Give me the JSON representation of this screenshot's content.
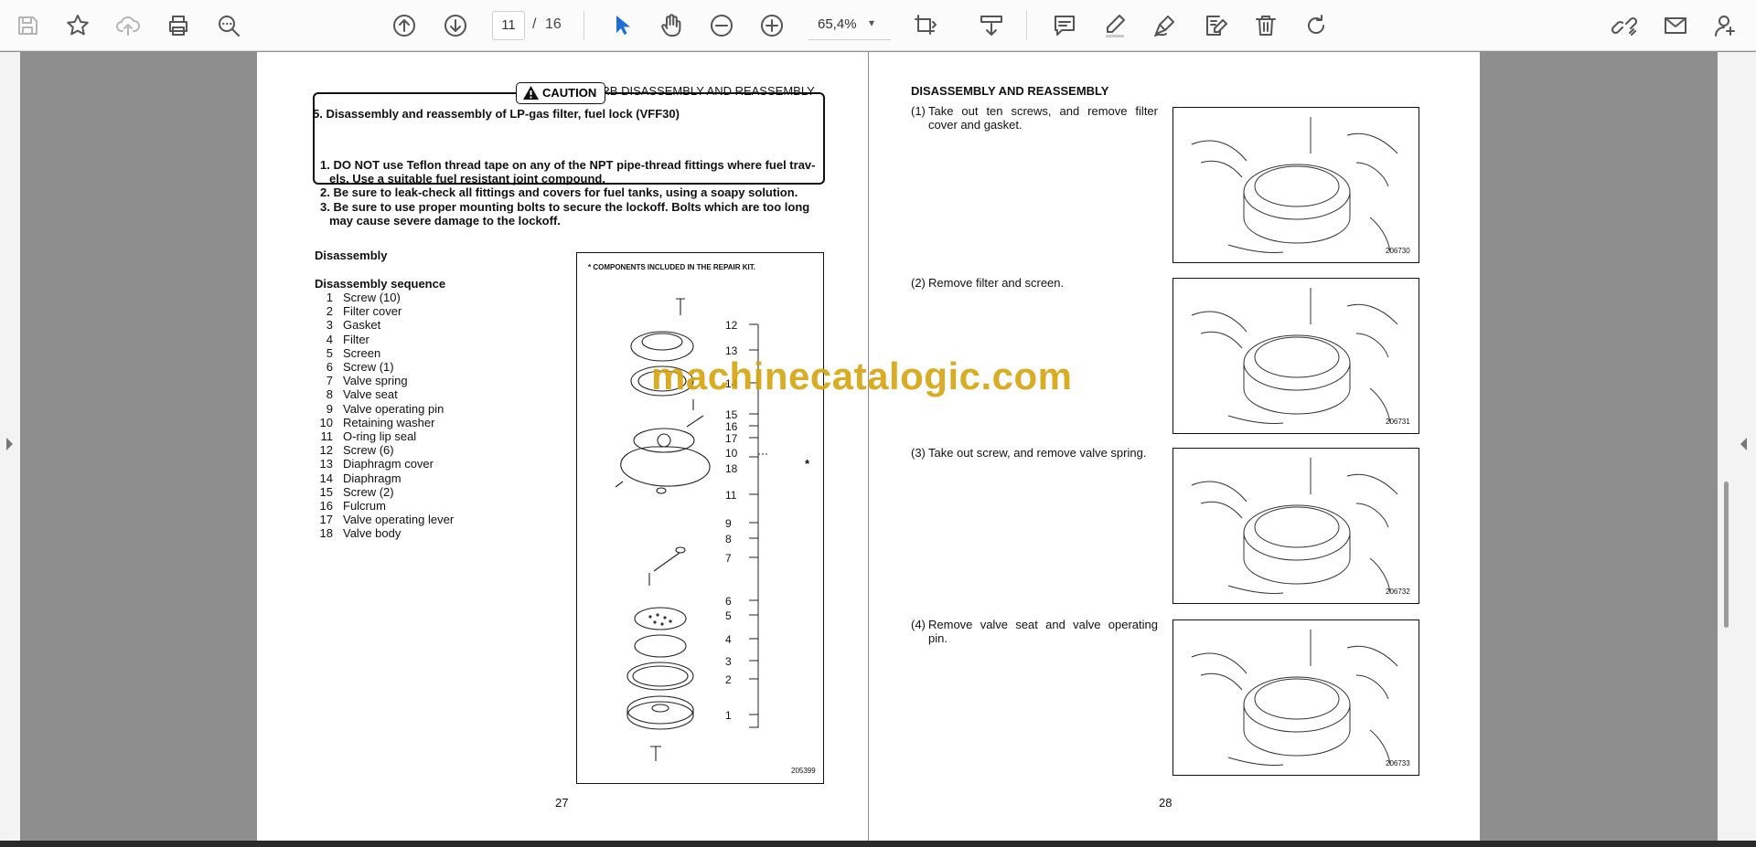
{
  "toolbar": {
    "page_current": "11",
    "page_separator": "/",
    "page_total": "16",
    "zoom": "65,4%",
    "zoom_caret": "▾"
  },
  "left_page": {
    "header": "PRE CARB DISASSEMBLY AND REASSEMBLY",
    "section_title": "5. Disassembly and reassembly of LP-gas filter, fuel lock (VFF30)",
    "caution_label": "CAUTION",
    "caution_items": [
      "1. DO NOT use Teflon thread tape on any of the NPT pipe-thread fittings where fuel trav-",
      "els. Use a suitable fuel resistant joint compound.",
      "2. Be sure to leak-check all fittings and covers for fuel tanks, using a soapy solution.",
      "3. Be sure to use proper mounting bolts to secure the lockoff. Bolts which are too long",
      "may cause severe damage to the lockoff."
    ],
    "disassembly_heading": "Disassembly",
    "sequence_heading": "Disassembly sequence",
    "sequence": [
      {
        "num": "1",
        "label": "Screw (10)"
      },
      {
        "num": "2",
        "label": "Filter cover"
      },
      {
        "num": "3",
        "label": "Gasket"
      },
      {
        "num": "4",
        "label": "Filter"
      },
      {
        "num": "5",
        "label": "Screen"
      },
      {
        "num": "6",
        "label": "Screw (1)"
      },
      {
        "num": "7",
        "label": "Valve spring"
      },
      {
        "num": "8",
        "label": "Valve seat"
      },
      {
        "num": "9",
        "label": "Valve operating pin"
      },
      {
        "num": "10",
        "label": "Retaining washer"
      },
      {
        "num": "11",
        "label": "O-ring lip seal"
      },
      {
        "num": "12",
        "label": "Screw (6)"
      },
      {
        "num": "13",
        "label": "Diaphragm cover"
      },
      {
        "num": "14",
        "label": "Diaphragm"
      },
      {
        "num": "15",
        "label": "Screw (2)"
      },
      {
        "num": "16",
        "label": "Fulcrum"
      },
      {
        "num": "17",
        "label": "Valve operating lever"
      },
      {
        "num": "18",
        "label": "Valve body"
      }
    ],
    "diagram_note": "* COMPONENTS INCLUDED IN THE REPAIR KIT.",
    "diagram_callouts": [
      "12",
      "13",
      "14",
      "15",
      "16",
      "17",
      "10",
      "18",
      "11",
      "9",
      "8",
      "7",
      "6",
      "5",
      "4",
      "3",
      "2",
      "1"
    ],
    "diagram_star": "*",
    "diagram_id": "205399",
    "page_number": "27"
  },
  "right_page": {
    "header": "DISASSEMBLY AND REASSEMBLY",
    "steps": [
      {
        "num": "(1)",
        "line1": "Take out ten screws, and remove filter",
        "line2": "cover and gasket.",
        "image_id": "206730"
      },
      {
        "num": "(2)",
        "line1": "Remove filter and screen.",
        "line2": "",
        "image_id": "206731"
      },
      {
        "num": "(3)",
        "line1": "Take out screw, and remove valve spring.",
        "line2": "",
        "image_id": "206732"
      },
      {
        "num": "(4)",
        "line1": "Remove valve seat and valve operating",
        "line2": "pin.",
        "image_id": "206733"
      }
    ],
    "page_number": "28"
  },
  "watermark": "machinecatalogic.com",
  "icons": [
    "save-icon",
    "bookmark-star-icon",
    "cloud-upload-icon",
    "print-icon",
    "zoom-search-icon",
    "page-up-icon",
    "page-down-icon",
    "select-cursor-icon",
    "hand-pan-icon",
    "zoom-out-icon",
    "zoom-in-icon",
    "crop-tool-icon",
    "scroll-mode-icon",
    "comment-icon",
    "highlight-pen-icon",
    "draw-icon",
    "edit-text-icon",
    "delete-icon",
    "rotate-icon",
    "share-link-icon",
    "email-icon",
    "add-user-icon"
  ]
}
